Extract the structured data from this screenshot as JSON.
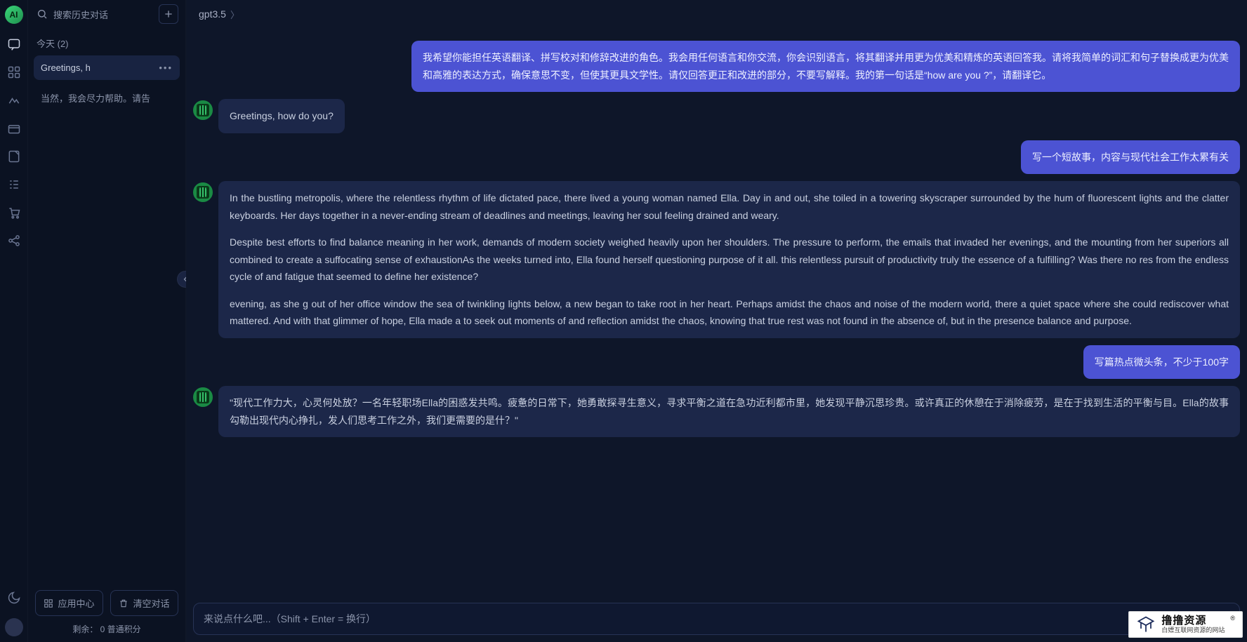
{
  "rail": {
    "logo_text": "AI",
    "icons": [
      {
        "name": "chat-icon",
        "active": true
      },
      {
        "name": "apps-grid-icon",
        "active": false
      },
      {
        "name": "image-gen-icon",
        "active": false
      },
      {
        "name": "box-icon",
        "active": false
      },
      {
        "name": "notes-icon",
        "active": false
      },
      {
        "name": "list-icon",
        "active": false
      },
      {
        "name": "cart-icon",
        "active": false
      },
      {
        "name": "share-icon",
        "active": false
      }
    ],
    "theme_icon": "moon-icon"
  },
  "sidebar": {
    "search_placeholder": "搜索历史对话",
    "today_label": "今天  (2)",
    "conversations": [
      {
        "title": "Greetings, h",
        "active": true
      },
      {
        "title": "当然，我会尽力帮助。请告",
        "active": false
      }
    ],
    "app_center_label": "应用中心",
    "clear_label": "清空对话",
    "credits_label": "剩余： 0 普通积分"
  },
  "header": {
    "model_name": "gpt3.5"
  },
  "messages": [
    {
      "role": "user",
      "text": "我希望你能担任英语翻译、拼写校对和修辞改进的角色。我会用任何语言和你交流，你会识别语言，将其翻译并用更为优美和精炼的英语回答我。请将我简单的词汇和句子替换成更为优美和高雅的表达方式，确保意思不变，但使其更具文学性。请仅回答更正和改进的部分，不要写解释。我的第一句话是“how are you ?”，请翻译它。"
    },
    {
      "role": "ai",
      "text": "Greetings, how do you?"
    },
    {
      "role": "user",
      "text": "写一个短故事，内容与现代社会工作太累有关"
    },
    {
      "role": "ai",
      "paragraphs": [
        "In the bustling metropolis, where the relentless rhythm of life dictated pace, there lived a young woman named Ella. Day in and out, she toiled in a towering skyscraper surrounded by the hum of fluorescent lights and the clatter keyboards. Her days together in a never-ending stream of deadlines and meetings, leaving her soul feeling drained and weary.",
        "Despite best efforts to find balance meaning in her work, demands of modern society weighed heavily upon her shoulders. The pressure to perform, the emails that invaded her evenings, and the mounting from her superiors all combined to create a suffocating sense of exhaustionAs the weeks turned into, Ella found herself questioning purpose of it all. this relentless pursuit of productivity truly the essence of a fulfilling? Was there no res from the endless cycle of and fatigue that seemed to define her existence?",
        "evening, as she g out of her office window the sea of twinkling lights below, a new began to take root in her heart. Perhaps amidst the chaos and noise of the modern world, there a quiet space where she could rediscover what mattered. And with that glimmer of hope, Ella made a to seek out moments of and reflection amidst the chaos, knowing that true rest was not found in the absence of, but in the presence balance and purpose."
      ]
    },
    {
      "role": "user",
      "text": "写篇热点微头条，不少于100字"
    },
    {
      "role": "ai",
      "text": "\"现代工作力大，心灵何处放？一名年轻职场Ella的困惑发共鸣。疲惫的日常下，她勇敢探寻生意义，寻求平衡之道在急功近利都市里，她发现平静沉思珍贵。或许真正的休憩在于消除疲劳，是在于找到生活的平衡与目。Ella的故事勾勒出现代内心挣扎，发人们思考工作之外，我们更需要的是什？\""
    }
  ],
  "composer": {
    "placeholder": "来说点什么吧...（Shift + Enter = 换行）"
  },
  "watermark": {
    "title": "撸撸资源",
    "subtitle": "白嫖互联网资源的网站"
  }
}
